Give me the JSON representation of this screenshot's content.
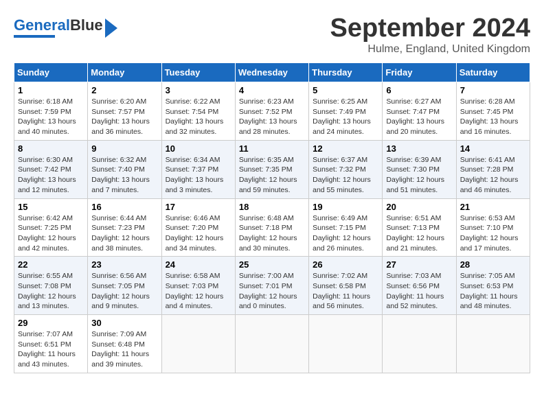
{
  "header": {
    "logo_text1": "General",
    "logo_text2": "Blue",
    "month_title": "September 2024",
    "location": "Hulme, England, United Kingdom"
  },
  "days_of_week": [
    "Sunday",
    "Monday",
    "Tuesday",
    "Wednesday",
    "Thursday",
    "Friday",
    "Saturday"
  ],
  "weeks": [
    [
      {
        "day": "1",
        "info": "Sunrise: 6:18 AM\nSunset: 7:59 PM\nDaylight: 13 hours\nand 40 minutes."
      },
      {
        "day": "2",
        "info": "Sunrise: 6:20 AM\nSunset: 7:57 PM\nDaylight: 13 hours\nand 36 minutes."
      },
      {
        "day": "3",
        "info": "Sunrise: 6:22 AM\nSunset: 7:54 PM\nDaylight: 13 hours\nand 32 minutes."
      },
      {
        "day": "4",
        "info": "Sunrise: 6:23 AM\nSunset: 7:52 PM\nDaylight: 13 hours\nand 28 minutes."
      },
      {
        "day": "5",
        "info": "Sunrise: 6:25 AM\nSunset: 7:49 PM\nDaylight: 13 hours\nand 24 minutes."
      },
      {
        "day": "6",
        "info": "Sunrise: 6:27 AM\nSunset: 7:47 PM\nDaylight: 13 hours\nand 20 minutes."
      },
      {
        "day": "7",
        "info": "Sunrise: 6:28 AM\nSunset: 7:45 PM\nDaylight: 13 hours\nand 16 minutes."
      }
    ],
    [
      {
        "day": "8",
        "info": "Sunrise: 6:30 AM\nSunset: 7:42 PM\nDaylight: 13 hours\nand 12 minutes."
      },
      {
        "day": "9",
        "info": "Sunrise: 6:32 AM\nSunset: 7:40 PM\nDaylight: 13 hours\nand 7 minutes."
      },
      {
        "day": "10",
        "info": "Sunrise: 6:34 AM\nSunset: 7:37 PM\nDaylight: 13 hours\nand 3 minutes."
      },
      {
        "day": "11",
        "info": "Sunrise: 6:35 AM\nSunset: 7:35 PM\nDaylight: 12 hours\nand 59 minutes."
      },
      {
        "day": "12",
        "info": "Sunrise: 6:37 AM\nSunset: 7:32 PM\nDaylight: 12 hours\nand 55 minutes."
      },
      {
        "day": "13",
        "info": "Sunrise: 6:39 AM\nSunset: 7:30 PM\nDaylight: 12 hours\nand 51 minutes."
      },
      {
        "day": "14",
        "info": "Sunrise: 6:41 AM\nSunset: 7:28 PM\nDaylight: 12 hours\nand 46 minutes."
      }
    ],
    [
      {
        "day": "15",
        "info": "Sunrise: 6:42 AM\nSunset: 7:25 PM\nDaylight: 12 hours\nand 42 minutes."
      },
      {
        "day": "16",
        "info": "Sunrise: 6:44 AM\nSunset: 7:23 PM\nDaylight: 12 hours\nand 38 minutes."
      },
      {
        "day": "17",
        "info": "Sunrise: 6:46 AM\nSunset: 7:20 PM\nDaylight: 12 hours\nand 34 minutes."
      },
      {
        "day": "18",
        "info": "Sunrise: 6:48 AM\nSunset: 7:18 PM\nDaylight: 12 hours\nand 30 minutes."
      },
      {
        "day": "19",
        "info": "Sunrise: 6:49 AM\nSunset: 7:15 PM\nDaylight: 12 hours\nand 26 minutes."
      },
      {
        "day": "20",
        "info": "Sunrise: 6:51 AM\nSunset: 7:13 PM\nDaylight: 12 hours\nand 21 minutes."
      },
      {
        "day": "21",
        "info": "Sunrise: 6:53 AM\nSunset: 7:10 PM\nDaylight: 12 hours\nand 17 minutes."
      }
    ],
    [
      {
        "day": "22",
        "info": "Sunrise: 6:55 AM\nSunset: 7:08 PM\nDaylight: 12 hours\nand 13 minutes."
      },
      {
        "day": "23",
        "info": "Sunrise: 6:56 AM\nSunset: 7:05 PM\nDaylight: 12 hours\nand 9 minutes."
      },
      {
        "day": "24",
        "info": "Sunrise: 6:58 AM\nSunset: 7:03 PM\nDaylight: 12 hours\nand 4 minutes."
      },
      {
        "day": "25",
        "info": "Sunrise: 7:00 AM\nSunset: 7:01 PM\nDaylight: 12 hours\nand 0 minutes."
      },
      {
        "day": "26",
        "info": "Sunrise: 7:02 AM\nSunset: 6:58 PM\nDaylight: 11 hours\nand 56 minutes."
      },
      {
        "day": "27",
        "info": "Sunrise: 7:03 AM\nSunset: 6:56 PM\nDaylight: 11 hours\nand 52 minutes."
      },
      {
        "day": "28",
        "info": "Sunrise: 7:05 AM\nSunset: 6:53 PM\nDaylight: 11 hours\nand 48 minutes."
      }
    ],
    [
      {
        "day": "29",
        "info": "Sunrise: 7:07 AM\nSunset: 6:51 PM\nDaylight: 11 hours\nand 43 minutes."
      },
      {
        "day": "30",
        "info": "Sunrise: 7:09 AM\nSunset: 6:48 PM\nDaylight: 11 hours\nand 39 minutes."
      },
      {
        "day": "",
        "info": ""
      },
      {
        "day": "",
        "info": ""
      },
      {
        "day": "",
        "info": ""
      },
      {
        "day": "",
        "info": ""
      },
      {
        "day": "",
        "info": ""
      }
    ]
  ]
}
